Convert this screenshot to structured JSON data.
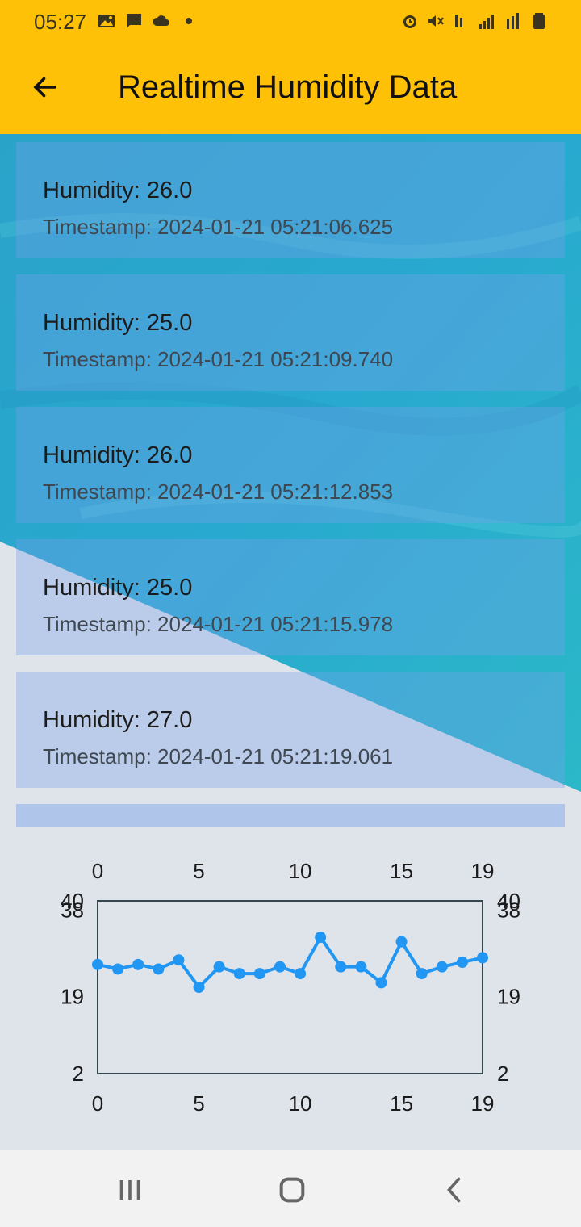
{
  "status": {
    "time": "05:27"
  },
  "appbar": {
    "title": "Realtime Humidity Data"
  },
  "cards": [
    {
      "humidity": "Humidity: 26.0",
      "timestamp": "Timestamp: 2024-01-21 05:21:06.625"
    },
    {
      "humidity": "Humidity: 25.0",
      "timestamp": "Timestamp: 2024-01-21 05:21:09.740"
    },
    {
      "humidity": "Humidity: 26.0",
      "timestamp": "Timestamp: 2024-01-21 05:21:12.853"
    },
    {
      "humidity": "Humidity: 25.0",
      "timestamp": "Timestamp: 2024-01-21 05:21:15.978"
    },
    {
      "humidity": "Humidity: 27.0",
      "timestamp": "Timestamp: 2024-01-21 05:21:19.061"
    }
  ],
  "chart_data": {
    "type": "line",
    "x": [
      0,
      1,
      2,
      3,
      4,
      5,
      6,
      7,
      8,
      9,
      10,
      11,
      12,
      13,
      14,
      15,
      16,
      17,
      18,
      19
    ],
    "y": [
      26,
      25,
      26,
      25,
      27,
      21,
      25.5,
      24,
      24,
      25.5,
      24,
      32,
      25.5,
      25.5,
      22,
      31,
      24,
      25.5,
      26.5,
      27.5
    ],
    "xlim": [
      0,
      19
    ],
    "ylim": [
      2,
      40
    ],
    "xticks": [
      "0",
      "5",
      "10",
      "15",
      "19"
    ],
    "xtick_values": [
      0,
      5,
      10,
      15,
      19
    ],
    "yticks": [
      "2",
      "19",
      "38",
      "40"
    ],
    "ytick_values": [
      2,
      19,
      38,
      40
    ],
    "line_color": "#2196F3",
    "grid": false
  },
  "colors": {
    "appbar": "#FFC107",
    "accent": "#2196F3"
  }
}
